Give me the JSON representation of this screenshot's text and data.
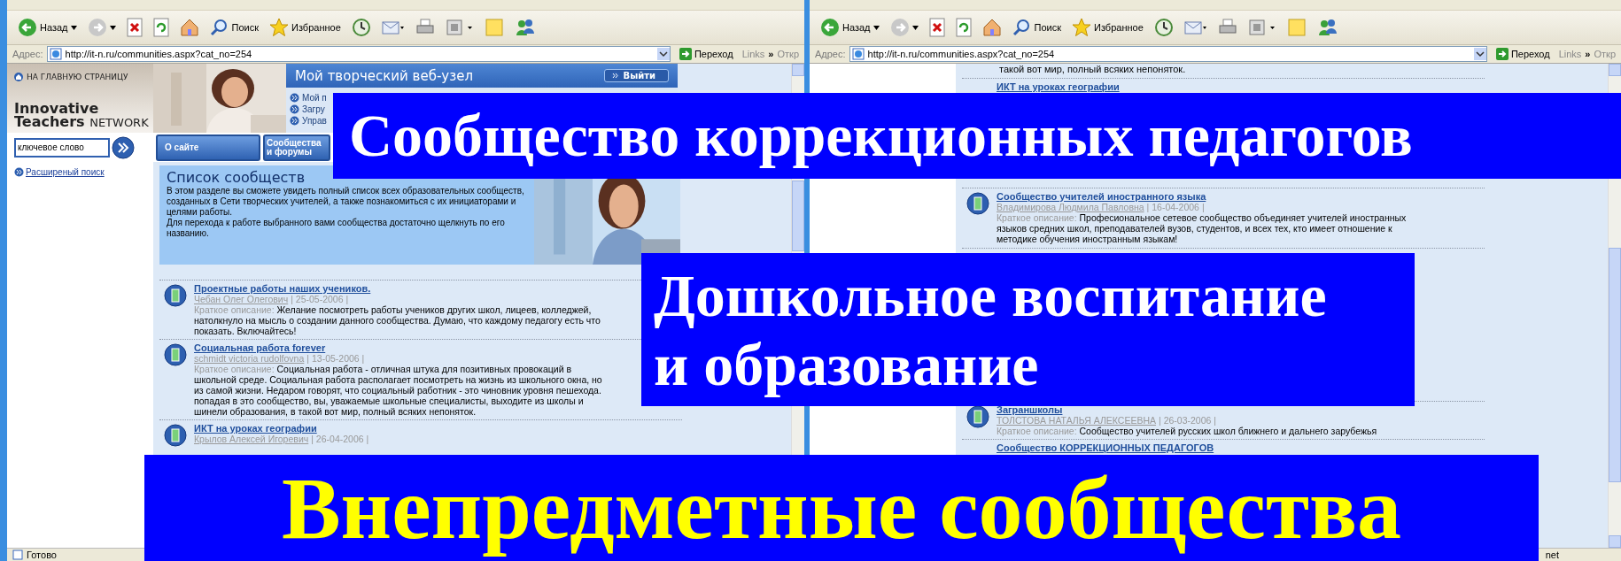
{
  "windows": [
    {
      "toolbar": [
        {
          "kind": "back",
          "label": "Назад"
        },
        {
          "kind": "forward"
        },
        {
          "kind": "stop"
        },
        {
          "kind": "refresh"
        },
        {
          "kind": "home"
        },
        {
          "kind": "search",
          "label": "Поиск"
        },
        {
          "kind": "favorites",
          "label": "Избранное"
        },
        {
          "kind": "history"
        },
        {
          "kind": "mail"
        },
        {
          "kind": "print"
        },
        {
          "kind": "edit"
        },
        {
          "kind": "notes"
        },
        {
          "kind": "messenger"
        }
      ],
      "address_label": "Адрес:",
      "url": "http://it-n.ru/communities.aspx?cat_no=254",
      "go": "Переход",
      "links": "Links",
      "links_more": "»",
      "extra": "Откр",
      "status": "Готово"
    },
    {
      "toolbar": [
        {
          "kind": "back",
          "label": "Назад"
        },
        {
          "kind": "forward"
        },
        {
          "kind": "stop"
        },
        {
          "kind": "refresh"
        },
        {
          "kind": "home"
        },
        {
          "kind": "search",
          "label": "Поиск"
        },
        {
          "kind": "favorites",
          "label": "Избранное"
        },
        {
          "kind": "history"
        },
        {
          "kind": "mail"
        },
        {
          "kind": "print"
        },
        {
          "kind": "edit"
        },
        {
          "kind": "notes"
        },
        {
          "kind": "messenger"
        }
      ],
      "address_label": "Адрес:",
      "url": "http://it-n.ru/communities.aspx?cat_no=254",
      "go": "Переход",
      "links": "Links",
      "links_more": "»",
      "extra": "Откр",
      "status_zone": "net"
    }
  ],
  "left_page": {
    "home_link": "НА ГЛАВНУЮ СТРАНИЦУ",
    "logo": {
      "line1": "Innovative",
      "line2": "Teachers",
      "line3": "NETWORK"
    },
    "portal_title": "Мой творческий веб-узел",
    "logout": "Выйти",
    "portal_links": [
      "Мой п",
      "Загру",
      "Управ"
    ],
    "search": {
      "value": "ключевое слово"
    },
    "advanced_search": "Расширеный поиск",
    "tabs": [
      "О сайте",
      "Сообщества и форумы"
    ],
    "intro": {
      "title": "Список сообществ",
      "paragraphs": [
        "В этом разделе вы сможете увидеть полный список всех образовательных сообществ, созданных в Сети творческих учителей, а также познакомиться с их инициаторами и целями работы.",
        "Для перехода к работе выбранного вами сообщества достаточно щелкнуть по его названию."
      ]
    },
    "communities": [
      {
        "title": "Проектные работы наших учеников.",
        "author": "Чебан Олег Олегович",
        "date": "| 25-05-2006 |",
        "description_label": "Краткое описание:",
        "description": "Желание посмотреть работы учеников других школ, лицеев, колледжей, натолкнуло на мысль о создании данного сообщества. Думаю, что каждому педагогу есть что показать. Включайтесь!"
      },
      {
        "title": "Социальная работа forever",
        "author": "schmidt victoria rudolfovna",
        "date": "| 13-05-2006 |",
        "description_label": "Краткое описание:",
        "description": "Социальная работа - отличная штука для позитивных провокаций в школьной среде. Социальная работа располагает посмотреть на жизнь из школьного окна, но из самой жизни. Недаром говорят, что социальный работник - это чиновник уровня пешехода. попадая в это сообщество, вы, уважаемые школьные специалисты, выходите из школы и шинели образования, в такой вот мир, полный всяких непоняток."
      },
      {
        "title": "ИКТ на уроках географии",
        "author": "Крылов Алексей Игоревич",
        "date": "| 26-04-2006 |"
      }
    ]
  },
  "right_page": {
    "lead_text": "такой вот мир, полный всяких непоняток.",
    "communities": [
      {
        "title": "ИКТ на уроках географии"
      },
      {
        "title": "Сообщество учителей иностранного языка",
        "author": "Владимирова Людмила Павловна",
        "date": "| 16-04-2006 |",
        "description_label": "Краткое описание:",
        "description": "Професиональное сетевое сообщество объединяет учителей иностранных языков средних школ, преподавателей вузов, студентов, и всех тех, кто имеет отношение к методике обучения иностранным языкам!"
      }
    ],
    "lower_communities": [
      {
        "title": "Заграншколы",
        "author": "ТОЛСТОВА НАТАЛЬЯ АЛЕКСЕЕВНА",
        "date": "| 26-03-2006 |",
        "description_label": "Краткое описание:",
        "description": "Сообщество учителей русских школ ближнего и дальнего зарубежья"
      },
      {
        "title": "Сообщество КОРРЕКЦИОННЫХ ПЕДАГОГОВ"
      }
    ]
  },
  "banners": [
    {
      "kind": "top",
      "lines": [
        "Сообщество коррекционных педагогов"
      ],
      "color": "#ffffff"
    },
    {
      "kind": "middle",
      "lines": [
        "Дошкольное воспитание",
        "и образование"
      ],
      "color": "#ffffff"
    },
    {
      "kind": "bottom",
      "lines": [
        "Внепредметные сообщества"
      ],
      "color": "#ffff00"
    }
  ]
}
